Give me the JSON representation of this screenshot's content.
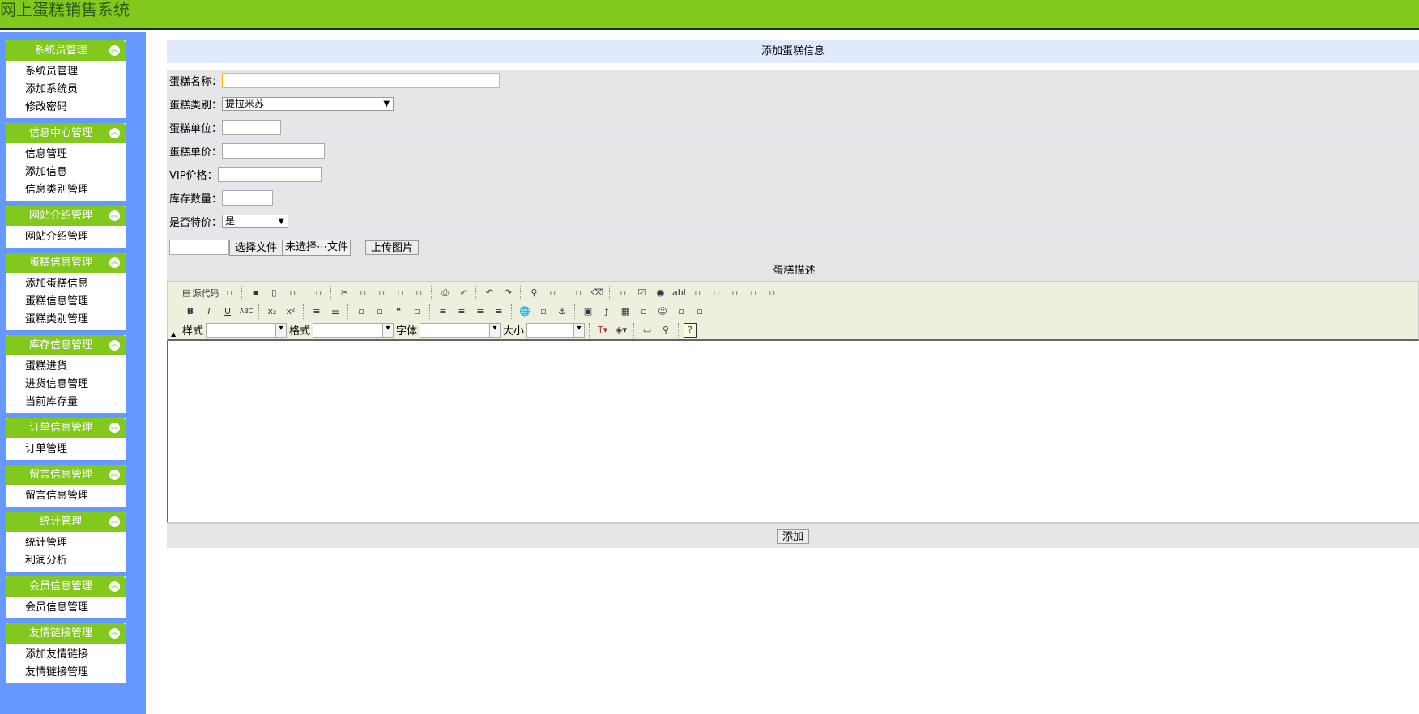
{
  "app_title": "网上蛋糕销售系统",
  "sidebar": [
    {
      "title": "系统员管理",
      "items": [
        "系统员管理",
        "添加系统员",
        "修改密码"
      ]
    },
    {
      "title": "信息中心管理",
      "items": [
        "信息管理",
        "添加信息",
        "信息类别管理"
      ]
    },
    {
      "title": "网站介绍管理",
      "items": [
        "网站介绍管理"
      ]
    },
    {
      "title": "蛋糕信息管理",
      "items": [
        "添加蛋糕信息",
        "蛋糕信息管理",
        "蛋糕类别管理"
      ]
    },
    {
      "title": "库存信息管理",
      "items": [
        "蛋糕进货",
        "进货信息管理",
        "当前库存量"
      ]
    },
    {
      "title": "订单信息管理",
      "items": [
        "订单管理"
      ]
    },
    {
      "title": "留言信息管理",
      "items": [
        "留言信息管理"
      ]
    },
    {
      "title": "统计管理",
      "items": [
        "统计管理",
        "利润分析"
      ]
    },
    {
      "title": "会员信息管理",
      "items": [
        "会员信息管理"
      ]
    },
    {
      "title": "友情链接管理",
      "items": [
        "添加友情链接",
        "友情链接管理"
      ]
    }
  ],
  "form": {
    "title": "添加蛋糕信息",
    "name_label": "蛋糕名称：",
    "name_value": "",
    "type_label": "蛋糕类别：",
    "type_value": "提拉米苏",
    "unit_label": "蛋糕单位：",
    "unit_value": "",
    "price_label": "蛋糕单价：",
    "price_value": "",
    "vip_label": "VIP价格：",
    "vip_value": "",
    "stock_label": "库存数量：",
    "stock_value": "",
    "special_label": "是否特价：",
    "special_value": "是",
    "choose_file": "选择文件",
    "no_file": "未选择⋯文件",
    "upload": "上传图片",
    "desc_label": "蛋糕描述",
    "submit": "添加"
  },
  "editor": {
    "source": "源代码",
    "style_label": "样式",
    "format_label": "格式",
    "font_label": "字体",
    "size_label": "大小",
    "row1": [
      "copy-icon",
      "|",
      "save-icon",
      "new-page-icon",
      "preview-icon",
      "|",
      "templates-icon",
      "|",
      "cut-icon",
      "copy2-icon",
      "paste-icon",
      "paste-text-icon",
      "paste-word-icon",
      "|",
      "print-icon",
      "spellcheck-icon",
      "|",
      "undo-icon",
      "redo-icon",
      "|",
      "find-icon",
      "replace-icon",
      "|",
      "select-all-icon",
      "remove-format-icon",
      "|",
      "form-icon",
      "checkbox-icon",
      "radio-icon",
      "textfield-icon",
      "textarea-icon",
      "select-icon",
      "button-icon",
      "image-button-icon",
      "hidden-field-icon"
    ],
    "row2": [
      "bold-icon",
      "italic-icon",
      "underline-icon",
      "strike-icon",
      "|",
      "subscript-icon",
      "superscript-icon",
      "|",
      "ordered-list-icon",
      "unordered-list-icon",
      "|",
      "outdent-icon",
      "indent-icon",
      "blockquote-icon",
      "div-icon",
      "|",
      "align-left-icon",
      "align-center-icon",
      "align-right-icon",
      "justify-icon",
      "|",
      "link-icon",
      "unlink-icon",
      "anchor-icon",
      "|",
      "image-icon",
      "flash-icon",
      "table-icon",
      "rule-icon",
      "smiley-icon",
      "special-char-icon",
      "page-break-icon"
    ],
    "glyphs": {
      "bold-icon": "B",
      "italic-icon": "I",
      "underline-icon": "U",
      "strike-icon": "ABC",
      "subscript-icon": "x₂",
      "superscript-icon": "x²",
      "smiley-icon": "☺",
      "anchor-icon": "⚓",
      "print-icon": "⎙",
      "spellcheck-icon": "✔",
      "undo-icon": "↶",
      "redo-icon": "↷",
      "cut-icon": "✂",
      "checkbox-icon": "☑",
      "radio-icon": "◉",
      "find-icon": "⚲",
      "ordered-list-icon": "≡",
      "unordered-list-icon": "☰",
      "align-left-icon": "≡",
      "align-center-icon": "≡",
      "align-right-icon": "≡",
      "justify-icon": "≡",
      "blockquote-icon": "❝",
      "table-icon": "▦",
      "flash-icon": "ƒ",
      "link-icon": "🌐",
      "image-icon": "▣",
      "textfield-icon": "abl",
      "save-icon": "▪",
      "new-page-icon": "▯",
      "remove-format-icon": "⌫"
    }
  }
}
